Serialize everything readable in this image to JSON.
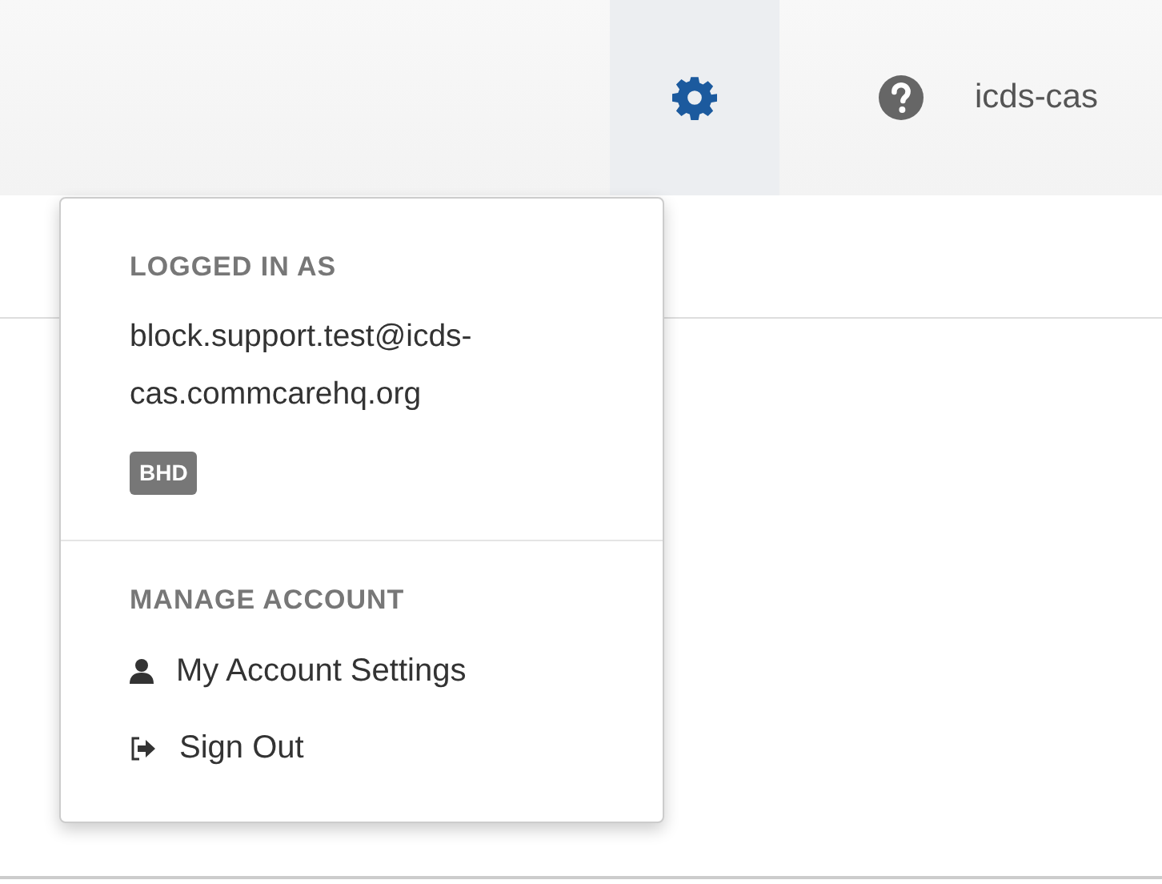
{
  "top_bar": {
    "settings_button": {
      "open": true
    },
    "domain": "icds-cas"
  },
  "account_menu": {
    "sections": [
      {
        "header": "LOGGED IN AS",
        "email": "block.support.test@icds-cas.commcarehq.org",
        "badge": "BHD"
      },
      {
        "header": "MANAGE ACCOUNT",
        "items": [
          {
            "kind": "user",
            "label": "My Account Settings"
          },
          {
            "kind": "signout",
            "label": "Sign Out"
          }
        ]
      }
    ]
  }
}
